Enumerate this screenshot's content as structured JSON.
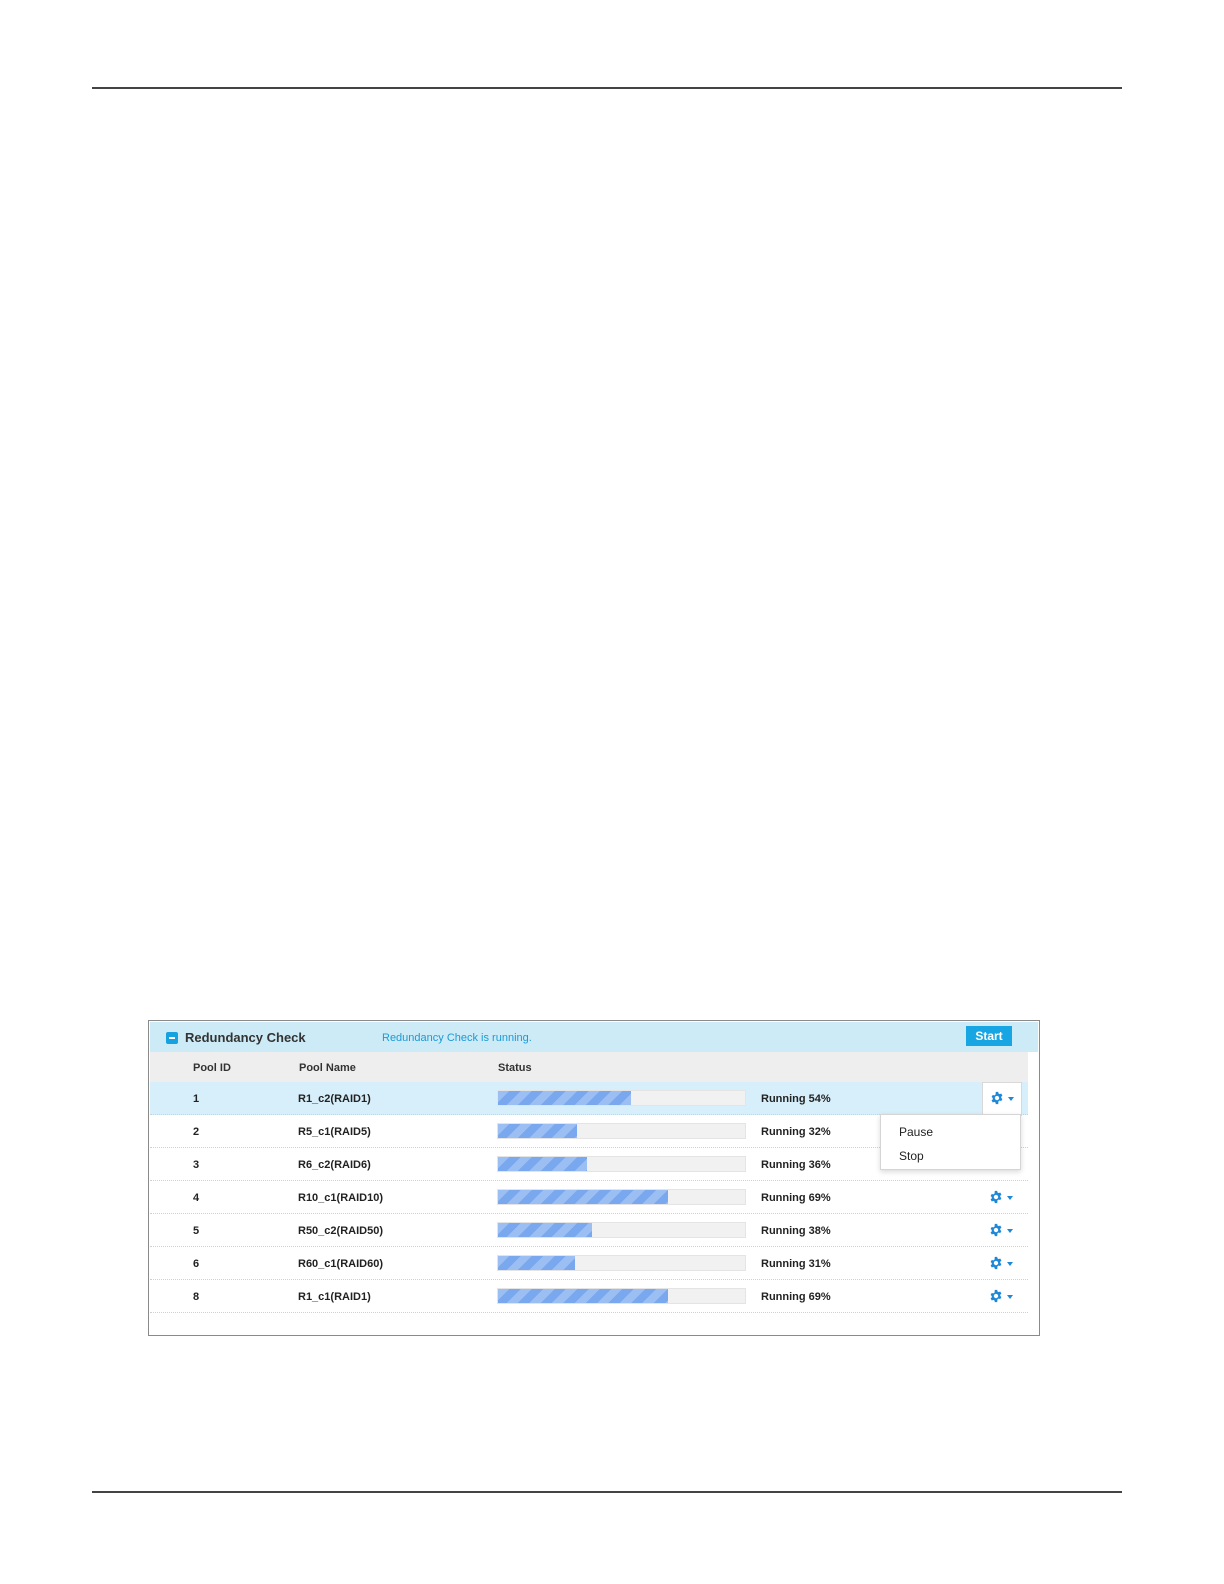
{
  "panel": {
    "title": "Redundancy Check",
    "status_message": "Redundancy Check is running.",
    "start_label": "Start"
  },
  "table": {
    "headers": [
      "Pool ID",
      "Pool Name",
      "Status"
    ],
    "rows": [
      {
        "id": "1",
        "name": "R1_c2(RAID1)",
        "status": "Running 54%",
        "progress": 0.54,
        "selected": true,
        "menu_open": true
      },
      {
        "id": "2",
        "name": "R5_c1(RAID5)",
        "status": "Running 32%",
        "progress": 0.32
      },
      {
        "id": "3",
        "name": "R6_c2(RAID6)",
        "status": "Running 36%",
        "progress": 0.36
      },
      {
        "id": "4",
        "name": "R10_c1(RAID10)",
        "status": "Running 69%",
        "progress": 0.69
      },
      {
        "id": "5",
        "name": "R50_c2(RAID50)",
        "status": "Running 38%",
        "progress": 0.38
      },
      {
        "id": "6",
        "name": "R60_c1(RAID60)",
        "status": "Running 31%",
        "progress": 0.31
      },
      {
        "id": "8",
        "name": "R1_c1(RAID1)",
        "status": "Running 69%",
        "progress": 0.69
      }
    ]
  },
  "action_menu": {
    "items": [
      "Pause",
      "Stop"
    ]
  },
  "icons": {
    "collapse": "minus-square-icon",
    "row_action": "gear-icon",
    "dropdown": "caret-down-icon"
  },
  "colors": {
    "accent": "#17a6e3",
    "progress_fill": "#7aa8ef",
    "header_bg": "#cdebf7",
    "selected_row": "#d7effa"
  }
}
